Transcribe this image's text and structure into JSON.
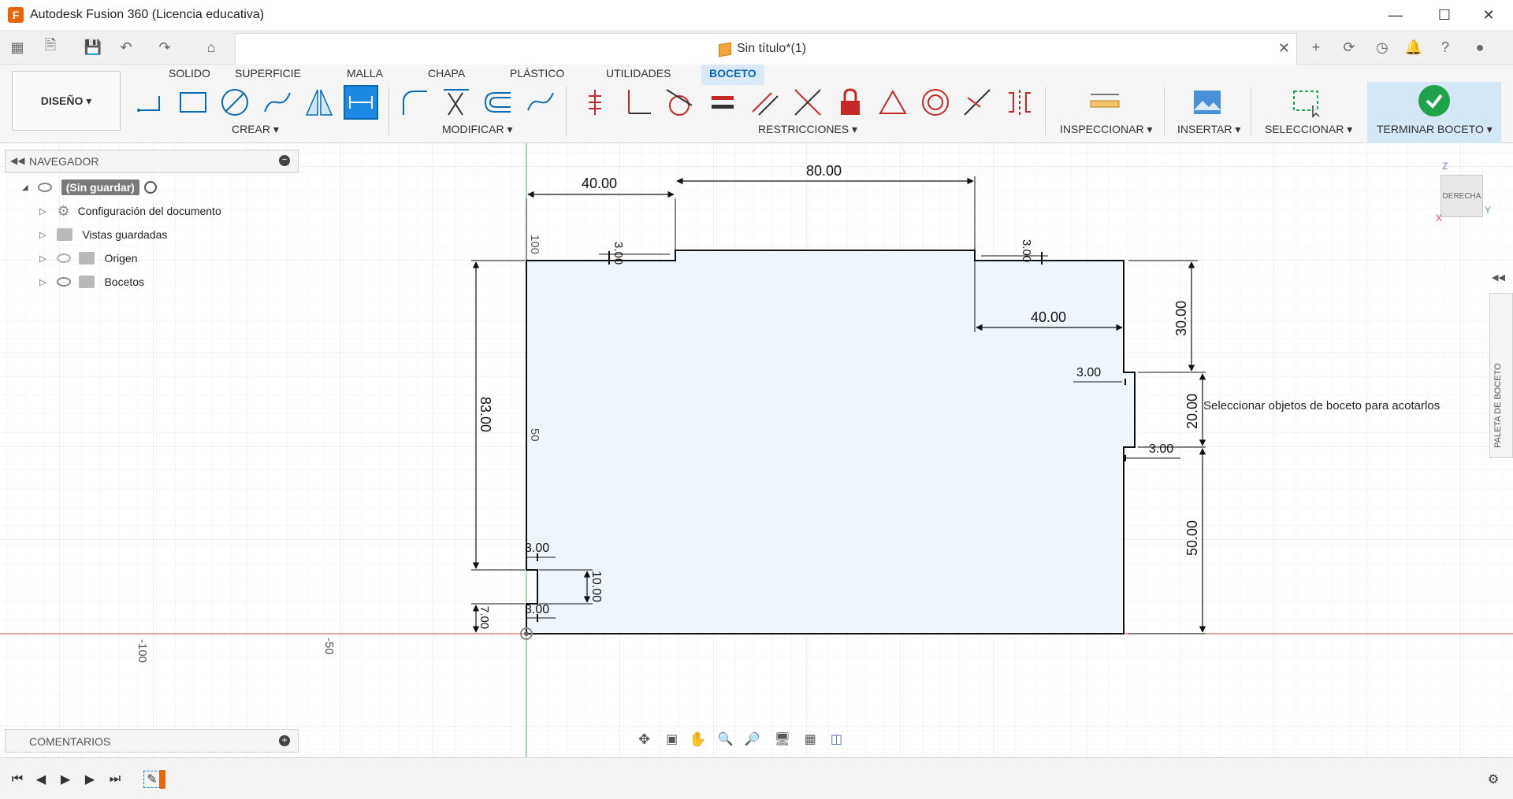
{
  "window": {
    "title": "Autodesk Fusion 360 (Licencia educativa)",
    "logo_letter": "F",
    "controls": [
      "minimize",
      "maximize",
      "close"
    ]
  },
  "document_tab": {
    "title": "Sin título*(1)"
  },
  "workspace": {
    "label": "DISEÑO ▾"
  },
  "ribbon": {
    "tabs": [
      {
        "label": "SOLIDO",
        "active": false
      },
      {
        "label": "SUPERFICIE",
        "active": false
      },
      {
        "label": "MALLA",
        "active": false
      },
      {
        "label": "CHAPA",
        "active": false
      },
      {
        "label": "PLÁSTICO",
        "active": false
      },
      {
        "label": "UTILIDADES",
        "active": false
      },
      {
        "label": "BOCETO",
        "active": true
      }
    ],
    "groups": {
      "crear": "CREAR ▾",
      "modificar": "MODIFICAR ▾",
      "restricciones": "RESTRICCIONES ▾",
      "inspeccionar": "INSPECCIONAR ▾",
      "insertar": "INSERTAR ▾",
      "seleccionar": "SELECCIONAR ▾",
      "terminar": "TERMINAR BOCETO ▾"
    },
    "accent_color": "#0a69b4",
    "constraint_color": "#c62828",
    "finish_color": "#1fa34a"
  },
  "navigator": {
    "title": "NAVEGADOR",
    "root": "(Sin guardar)",
    "items": [
      {
        "label": "Configuración del documento",
        "icon": "gear-icon"
      },
      {
        "label": "Vistas guardadas",
        "icon": "folder-icon"
      },
      {
        "label": "Origen",
        "icon": "folder-icon"
      },
      {
        "label": "Bocetos",
        "icon": "folder-icon"
      }
    ]
  },
  "comments": {
    "title": "COMENTARIOS"
  },
  "viewcube": {
    "face": "DERECHA",
    "axis_z": "Z",
    "axis_y": "Y",
    "axis_x": "X"
  },
  "palette": {
    "label": "PALETA DE BOCETO"
  },
  "tooltip": "Seleccionar objetos de boceto para acotarlos",
  "sketch": {
    "dimensions": {
      "top_left_width": "40.00",
      "top_middle_width": "80.00",
      "right_inner_width": "40.00",
      "left_step": "3.00",
      "right_step": "3.00",
      "right_notch_top": "3.00",
      "right_notch_bottom": "3.00",
      "bottom_left_notch_top": "3.00",
      "bottom_left_notch_bottom": "3.00",
      "left_height": "83.00",
      "bottom_left_height": "7.00",
      "notch_height": "10.00",
      "right_top_height": "30.00",
      "right_middle_height": "20.00",
      "right_bottom_height": "50.00"
    },
    "grid_labels": {
      "x_minus_100": "-100",
      "x_minus_50": "-50",
      "y_100": "100",
      "y_50": "50"
    },
    "profile_fill": "#eef5fb",
    "x_axis_color": "#e05050",
    "y_axis_color": "#4caf50"
  }
}
